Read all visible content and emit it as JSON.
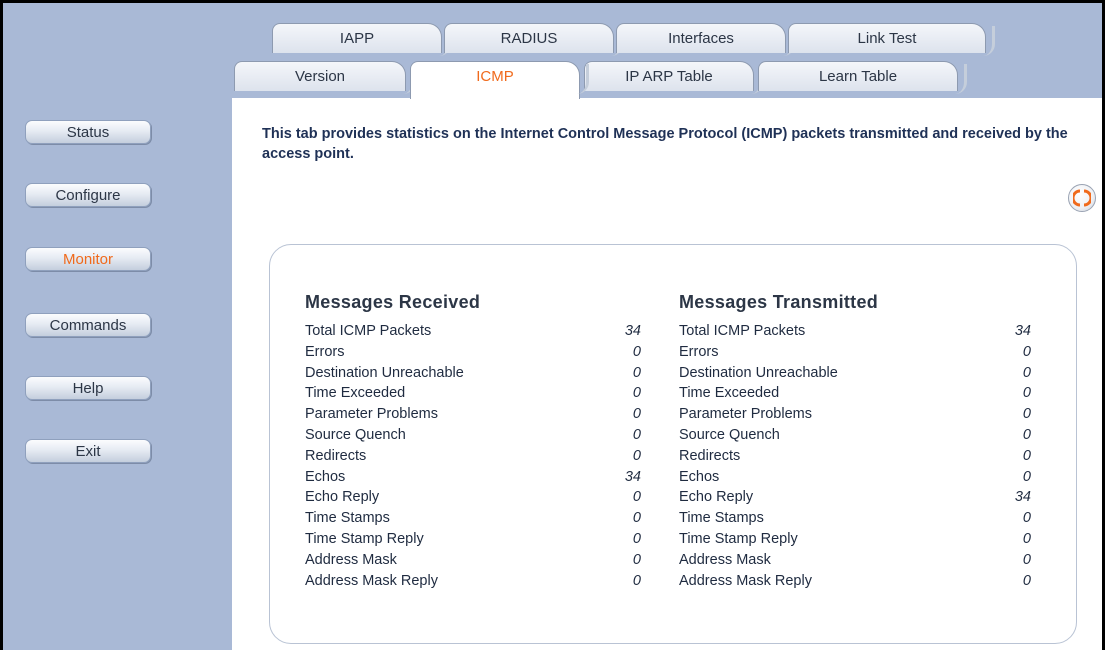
{
  "sidebar": {
    "items": [
      {
        "label": "Status"
      },
      {
        "label": "Configure"
      },
      {
        "label": "Monitor"
      },
      {
        "label": "Commands"
      },
      {
        "label": "Help"
      },
      {
        "label": "Exit"
      }
    ],
    "active": "Monitor"
  },
  "tabs": {
    "top_row": [
      "IAPP",
      "RADIUS",
      "Interfaces",
      "Link Test"
    ],
    "bottom_row": [
      "Version",
      "ICMP",
      "IP ARP Table",
      "Learn Table"
    ],
    "active": "ICMP"
  },
  "intro_text": "This tab provides statistics on the Internet Control Message Protocol (ICMP) packets transmitted and received by the access point.",
  "refresh_icon": "refresh-icon",
  "received": {
    "title": "Messages Received",
    "rows": [
      {
        "label": "Total ICMP Packets",
        "value": "34"
      },
      {
        "label": "Errors",
        "value": "0"
      },
      {
        "label": "Destination Unreachable",
        "value": "0"
      },
      {
        "label": "Time Exceeded",
        "value": "0"
      },
      {
        "label": "Parameter Problems",
        "value": "0"
      },
      {
        "label": "Source Quench",
        "value": "0"
      },
      {
        "label": "Redirects",
        "value": "0"
      },
      {
        "label": "Echos",
        "value": "34"
      },
      {
        "label": "Echo Reply",
        "value": "0"
      },
      {
        "label": "Time Stamps",
        "value": "0"
      },
      {
        "label": "Time Stamp Reply",
        "value": "0"
      },
      {
        "label": "Address Mask",
        "value": "0"
      },
      {
        "label": "Address Mask Reply",
        "value": "0"
      }
    ]
  },
  "transmitted": {
    "title": "Messages Transmitted",
    "rows": [
      {
        "label": "Total ICMP Packets",
        "value": "34"
      },
      {
        "label": "Errors",
        "value": "0"
      },
      {
        "label": "Destination Unreachable",
        "value": "0"
      },
      {
        "label": "Time Exceeded",
        "value": "0"
      },
      {
        "label": "Parameter Problems",
        "value": "0"
      },
      {
        "label": "Source Quench",
        "value": "0"
      },
      {
        "label": "Redirects",
        "value": "0"
      },
      {
        "label": "Echos",
        "value": "0"
      },
      {
        "label": "Echo Reply",
        "value": "34"
      },
      {
        "label": "Time Stamps",
        "value": "0"
      },
      {
        "label": "Time Stamp Reply",
        "value": "0"
      },
      {
        "label": "Address Mask",
        "value": "0"
      },
      {
        "label": "Address Mask Reply",
        "value": "0"
      }
    ]
  },
  "colors": {
    "sidebar_bg": "#a9b9d6",
    "active_accent": "#f06a1c",
    "heading_text": "#1f3156"
  }
}
